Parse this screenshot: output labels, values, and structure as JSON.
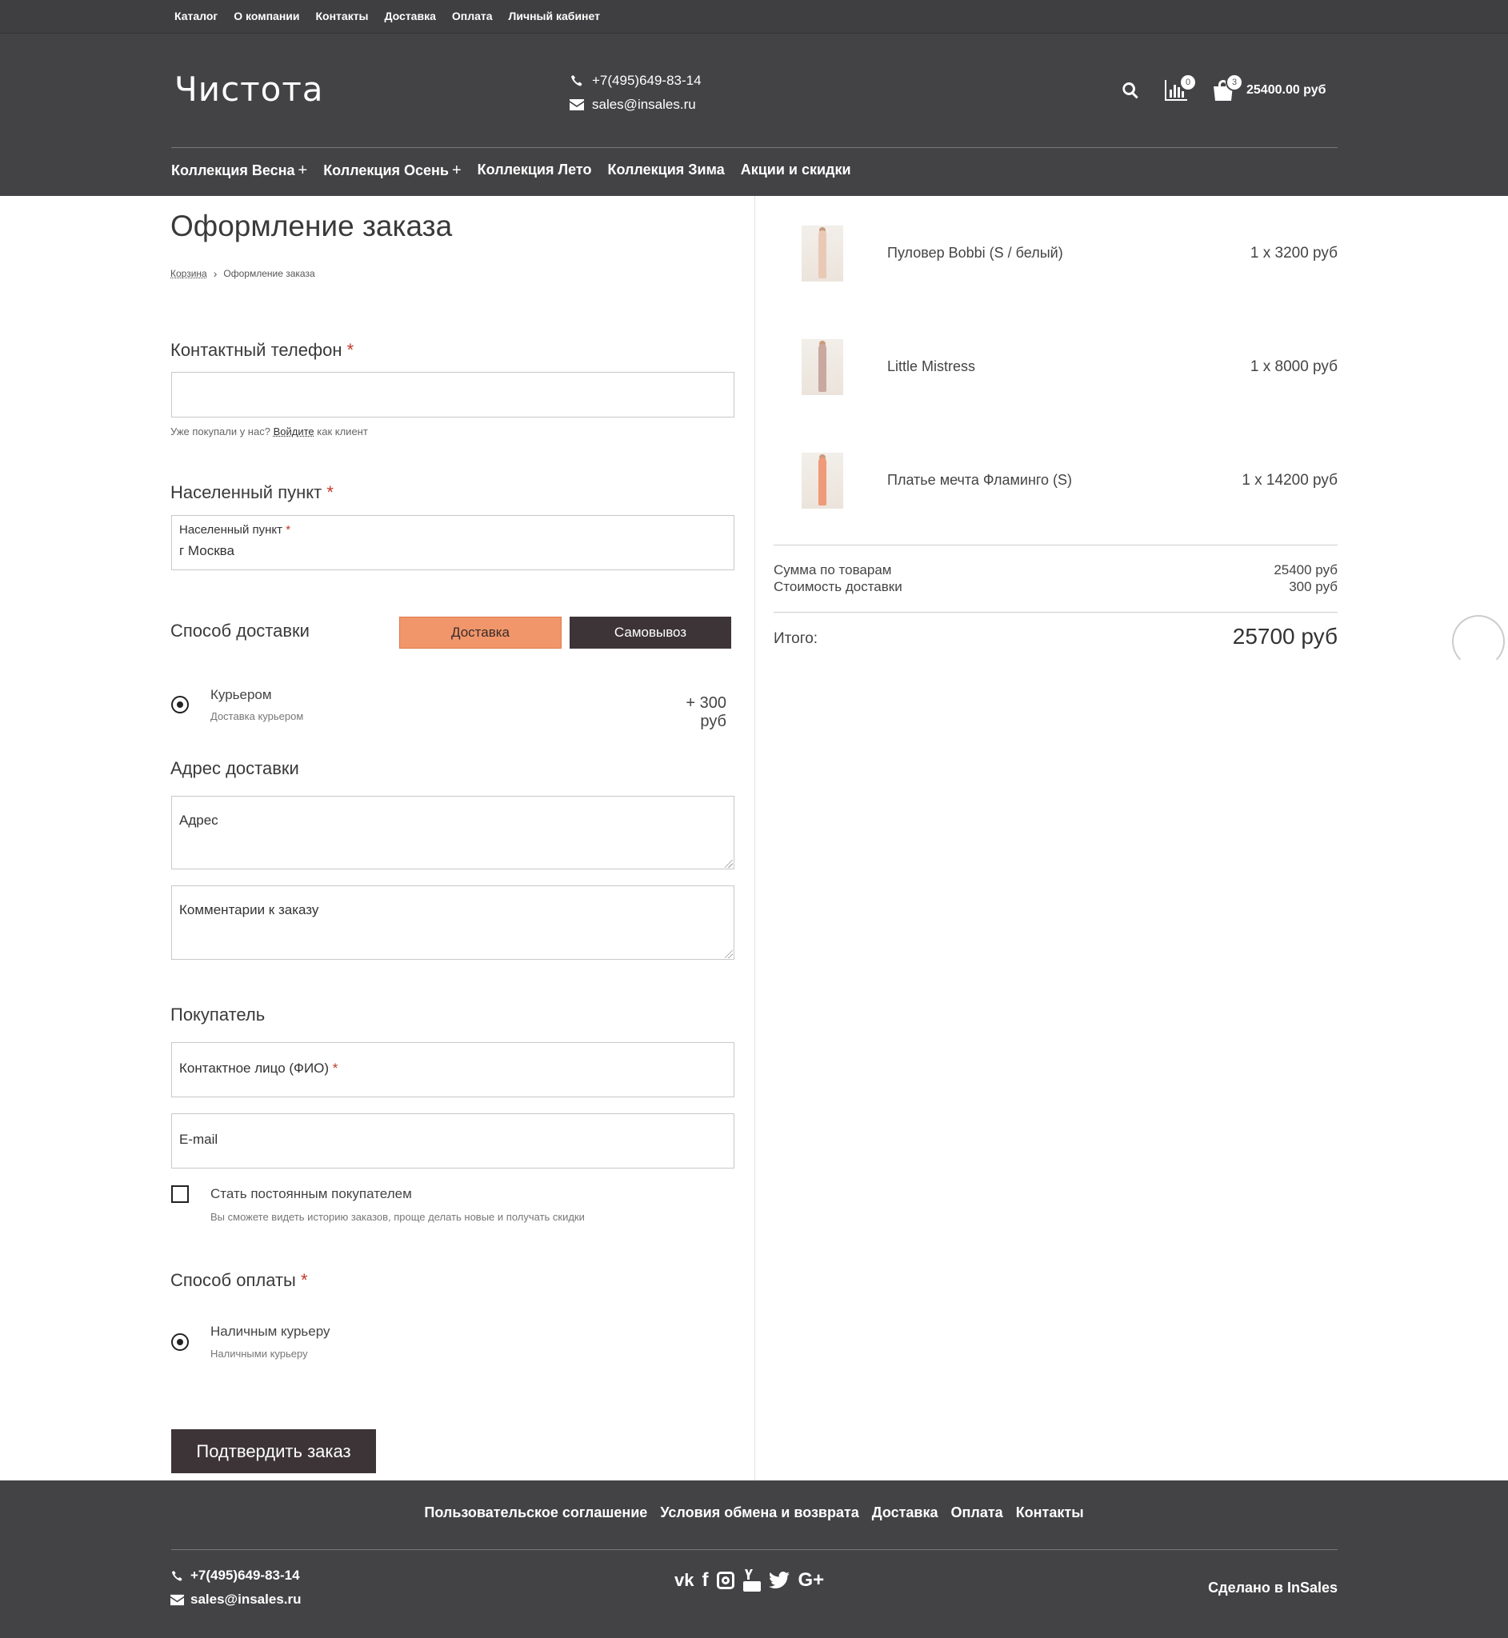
{
  "topbar": {
    "links": [
      "Каталог",
      "О компании",
      "Контакты",
      "Доставка",
      "Оплата",
      "Личный кабинет"
    ]
  },
  "header": {
    "logo": "Чистота",
    "phone": "+7(495)649-83-14",
    "email": "sales@insales.ru",
    "compare_count": "0",
    "cart_count": "3",
    "cart_total": "25400.00 руб"
  },
  "nav": {
    "items": [
      "Коллекция Весна",
      "Коллекция Осень",
      "Коллекция Лето",
      "Коллекция Зима",
      "Акции и скидки"
    ]
  },
  "page": {
    "title": "Оформление заказа",
    "breadcrumb": {
      "link": "Корзина",
      "current": "Оформление заказа"
    }
  },
  "form": {
    "phone": {
      "label": "Контактный телефон",
      "required": "*",
      "value": ""
    },
    "hint": {
      "prefix": "Уже покупали у нас?",
      "login": "Войдите",
      "suffix": "как клиент"
    },
    "city": {
      "label": "Населенный пункт",
      "required": "*",
      "inner_label": "Населенный пункт",
      "value": "г Москва"
    },
    "delivery": {
      "label": "Способ доставки",
      "btn_delivery": "Доставка",
      "btn_pickup": "Самовывоз",
      "option_title": "Курьером",
      "option_sub": "Доставка курьером",
      "option_price": "+ 300 руб"
    },
    "address": {
      "label": "Адрес доставки",
      "placeholder": "Адрес",
      "comment_placeholder": "Комментарии к заказу"
    },
    "buyer": {
      "label": "Покупатель",
      "name_placeholder": "Контактное лицо (ФИО)",
      "required": "*",
      "email_placeholder": "E-mail",
      "regular_title": "Стать постоянным покупателем",
      "regular_sub": "Вы сможете видеть историю заказов, проще делать новые и получать скидки"
    },
    "payment": {
      "label": "Способ оплаты",
      "required": "*",
      "option_title": "Наличным курьеру",
      "option_sub": "Наличными курьеру"
    },
    "submit": "Подтвердить заказ"
  },
  "cart": {
    "items": [
      {
        "name": "Пуловер Bobbi (S / белый)",
        "qty": "1 x 3200 руб",
        "color": "#e9c9b5"
      },
      {
        "name": "Little Mistress",
        "qty": "1 x 8000 руб",
        "color": "#c9a8a0"
      },
      {
        "name": "Платье мечта Фламинго (S)",
        "qty": "1 x 14200 руб",
        "color": "#ef9a78"
      }
    ],
    "subtotal_label": "Сумма по товарам",
    "subtotal_value": "25400 руб",
    "shipping_label": "Стоимость доставки",
    "shipping_value": "300 руб",
    "total_label": "Итого:",
    "total_value": "25700 руб"
  },
  "footer": {
    "links": [
      "Пользовательское соглашение",
      "Условия обмена и возврата",
      "Доставка",
      "Оплата",
      "Контакты"
    ],
    "phone": "+7(495)649-83-14",
    "email": "sales@insales.ru",
    "socials": [
      "vk-icon",
      "facebook-icon",
      "instagram-icon",
      "youtube-icon",
      "twitter-icon",
      "google-plus-icon"
    ],
    "made_by": "Сделано в InSales"
  },
  "colors": {
    "dark": "#434345",
    "accent": "#f0966a",
    "button": "#3d3438"
  }
}
